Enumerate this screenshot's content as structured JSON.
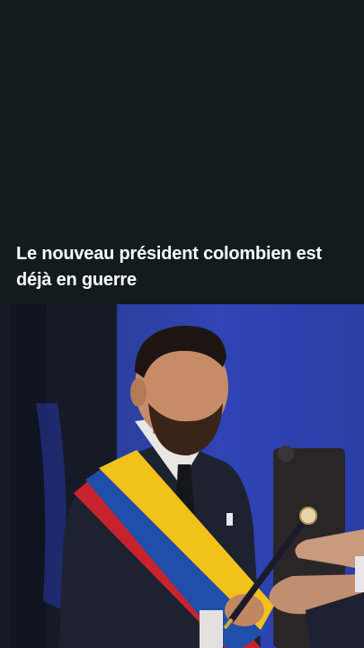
{
  "story": {
    "headline": "Le nouveau président colombien est déjà en guerre",
    "image": {
      "alt": "Le nouveau président colombien reçoit le bâton de commandement, portant l'écharpe présidentielle jaune, bleu et rouge",
      "icon": "photo"
    }
  },
  "colors": {
    "background": "#121c20",
    "headline": "#ffffff",
    "sash_yellow": "#f2c21b",
    "sash_blue": "#1f4fa8",
    "sash_red": "#c8232c",
    "stage_blue": "#2f44b5"
  }
}
